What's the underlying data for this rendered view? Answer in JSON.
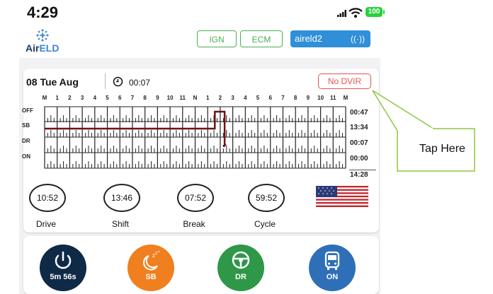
{
  "status_bar": {
    "time": "4:29",
    "battery": "100"
  },
  "logo": {
    "part1": "Air",
    "part2": "ELD"
  },
  "header": {
    "ign": "IGN",
    "ecm": "ECM",
    "device": "aireld2",
    "device_icon": "antenna-icon"
  },
  "log": {
    "date": "08 Tue Aug",
    "time": "00:07",
    "dvir_label": "No DVIR",
    "hours": [
      "M",
      "1",
      "2",
      "3",
      "4",
      "5",
      "6",
      "7",
      "8",
      "9",
      "10",
      "11",
      "N",
      "1",
      "2",
      "3",
      "4",
      "5",
      "6",
      "7",
      "8",
      "9",
      "10",
      "11",
      "M"
    ],
    "rows": [
      {
        "label": "OFF",
        "total": "00:47"
      },
      {
        "label": "SB",
        "total": "13:34"
      },
      {
        "label": "DR",
        "total": "00:07"
      },
      {
        "label": "ON",
        "total": "00:00"
      }
    ],
    "grand_total": "14:28",
    "duty_segments": [
      {
        "status": "SB",
        "from_hour": 0,
        "to_hour": 13.57
      },
      {
        "status": "OFF",
        "from_hour": 13.57,
        "to_hour": 14.35
      },
      {
        "status": "DR",
        "from_hour": 14.35,
        "to_hour": 14.47
      }
    ],
    "line_color": "#6b1414"
  },
  "stats": [
    {
      "value": "10:52",
      "label": "Drive"
    },
    {
      "value": "13:46",
      "label": "Shift"
    },
    {
      "value": "07:52",
      "label": "Break"
    },
    {
      "value": "59:52",
      "label": "Cycle"
    }
  ],
  "flag": "us-flag",
  "status_buttons": [
    {
      "label": "5m 56s",
      "icon": "power-icon",
      "color": "#0f2a47"
    },
    {
      "label": "SB",
      "icon": "sleep-icon",
      "color": "#f07f1f"
    },
    {
      "label": "DR",
      "icon": "steering-wheel-icon",
      "color": "#2e9748"
    },
    {
      "label": "ON",
      "icon": "bus-icon",
      "color": "#2f6fb8"
    }
  ],
  "callout": {
    "text": "Tap Here",
    "color": "#8dc63f"
  }
}
